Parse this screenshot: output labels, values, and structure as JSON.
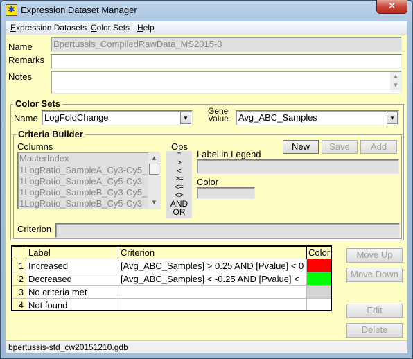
{
  "window": {
    "title": "Expression Dataset Manager",
    "close_label": "✕"
  },
  "menu": [
    {
      "label": "Expression Datasets",
      "key": "E",
      "rest": "xpression Datasets"
    },
    {
      "label": "Color Sets",
      "key": "C",
      "rest": "olor Sets"
    },
    {
      "label": "Help",
      "key": "H",
      "rest": "elp"
    }
  ],
  "dataset": {
    "name_label": "Name",
    "name_value": "Bpertussis_CompiledRawData_MS2015-3",
    "remarks_label": "Remarks",
    "remarks_value": "",
    "notes_label": "Notes",
    "notes_value": ""
  },
  "color_sets": {
    "title": "Color Sets",
    "name_label": "Name",
    "name_value": "LogFoldChange",
    "gene_value_label_1": "Gene",
    "gene_value_label_2": "Value",
    "gene_value": "Avg_ABC_Samples"
  },
  "criteria_builder": {
    "title": "Criteria Builder",
    "columns_label": "Columns",
    "columns": [
      "MasterIndex",
      "1LogRatio_SampleA_Cy3-Cy5_",
      "1LogRatio_SampleA_Cy5-Cy3",
      "1LogRatio_SampleB_Cy3-Cy5_",
      "1LogRatio_SampleB_Cy5-Cy3"
    ],
    "ops_label": "Ops",
    "ops": [
      "=",
      ">",
      "<",
      ">=",
      "<=",
      "<>",
      "AND",
      "OR"
    ],
    "label_in_legend_label": "Label in Legend",
    "label_in_legend_value": "",
    "color_label": "Color",
    "criterion_label": "Criterion",
    "criterion_value": "",
    "buttons": {
      "new": "New",
      "save": "Save",
      "add": "Add"
    }
  },
  "table": {
    "headers": [
      "Label",
      "Criterion",
      "Color"
    ],
    "rows": [
      {
        "n": "1",
        "label": "Increased",
        "criterion": "[Avg_ABC_Samples] > 0.25 AND [Pvalue] < 0",
        "color": "#ff0000"
      },
      {
        "n": "2",
        "label": "Decreased",
        "criterion": "[Avg_ABC_Samples] < -0.25 AND [Pvalue] <",
        "color": "#00ff00"
      },
      {
        "n": "3",
        "label": "No criteria met",
        "criterion": "",
        "color": "#d4d4d4"
      },
      {
        "n": "4",
        "label": "Not found",
        "criterion": "",
        "color": "#ffffff"
      }
    ]
  },
  "side_buttons": {
    "move_up": "Move Up",
    "move_down": "Move Down",
    "edit": "Edit",
    "delete": "Delete"
  },
  "status": {
    "text": "bpertussis-std_cw20151210.gdb"
  }
}
